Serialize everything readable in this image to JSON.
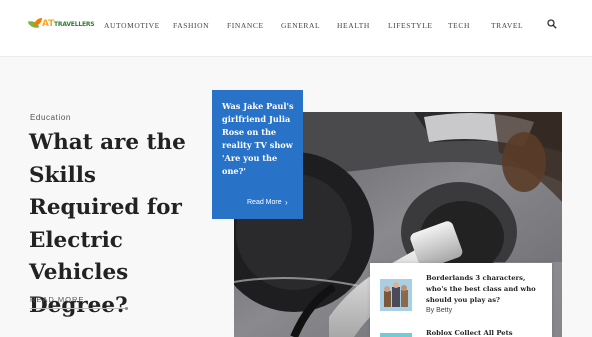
{
  "nav": {
    "items": [
      "AUTOMOTIVE",
      "FASHION",
      "FINANCE",
      "GENERAL",
      "HEALTH",
      "LIFESTYLE",
      "TECH",
      "TRAVEL"
    ]
  },
  "hero": {
    "category": "Education",
    "title": "What are the Skills Required for Electric Vehicles Degree?",
    "read_more": "READ MORE"
  },
  "featured": {
    "title": "Was Jake Paul's girlfriend Julia Rose on the reality TV show 'Are you the one?'",
    "link": "Read More",
    "arrow": "›"
  },
  "posts": [
    {
      "title": "Borderlands 3 characters, who's the best class and who should you play as?",
      "author": "By Betty"
    },
    {
      "title": "Roblox Collect All Pets"
    }
  ]
}
